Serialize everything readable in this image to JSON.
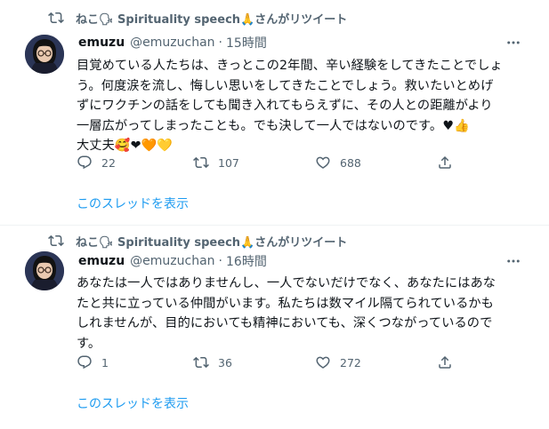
{
  "tweets": [
    {
      "retweet_label": "ねこ🗣 Spirituality speech🙏さんがリツイート",
      "author_name": "emuzu",
      "handle": "@emuzuchan",
      "separator": "·",
      "time": "15時間",
      "text_lines": [
        "目覚めている人たちは、きっとこの2年間、辛い経験をしてきたことでしょ",
        "う。何度涙を流し、悔しい思いをしてきたことでしょう。救いたいとめげ",
        "ずにワクチンの話をしても聞き入れてもらえずに、その人との距離がより",
        "一層広がってしまったことも。でも決して一人ではないのです。♥👍",
        "大丈夫🥰❤🧡💛"
      ],
      "replies": "22",
      "retweets": "107",
      "likes": "688",
      "thread_link": "このスレッドを表示"
    },
    {
      "retweet_label": "ねこ🗣 Spirituality speech🙏さんがリツイート",
      "author_name": "emuzu",
      "handle": "@emuzuchan",
      "separator": "·",
      "time": "16時間",
      "text_lines": [
        "あなたは一人ではありませんし、一人でないだけでなく、あなたにはあな",
        "たと共に立っている仲間がいます。私たちは数マイル隔てられているかも",
        "しれませんが、目的においても精神においても、深くつながっているので",
        "す。"
      ],
      "replies": "1",
      "retweets": "36",
      "likes": "272",
      "thread_link": "このスレッドを表示"
    }
  ],
  "colors": {
    "text": "#0f1419",
    "secondary": "#536471",
    "link": "#1d9bf0",
    "divider": "#eff3f4"
  },
  "icons": [
    "retweet-icon",
    "more-icon",
    "reply-icon",
    "like-icon",
    "share-icon"
  ]
}
